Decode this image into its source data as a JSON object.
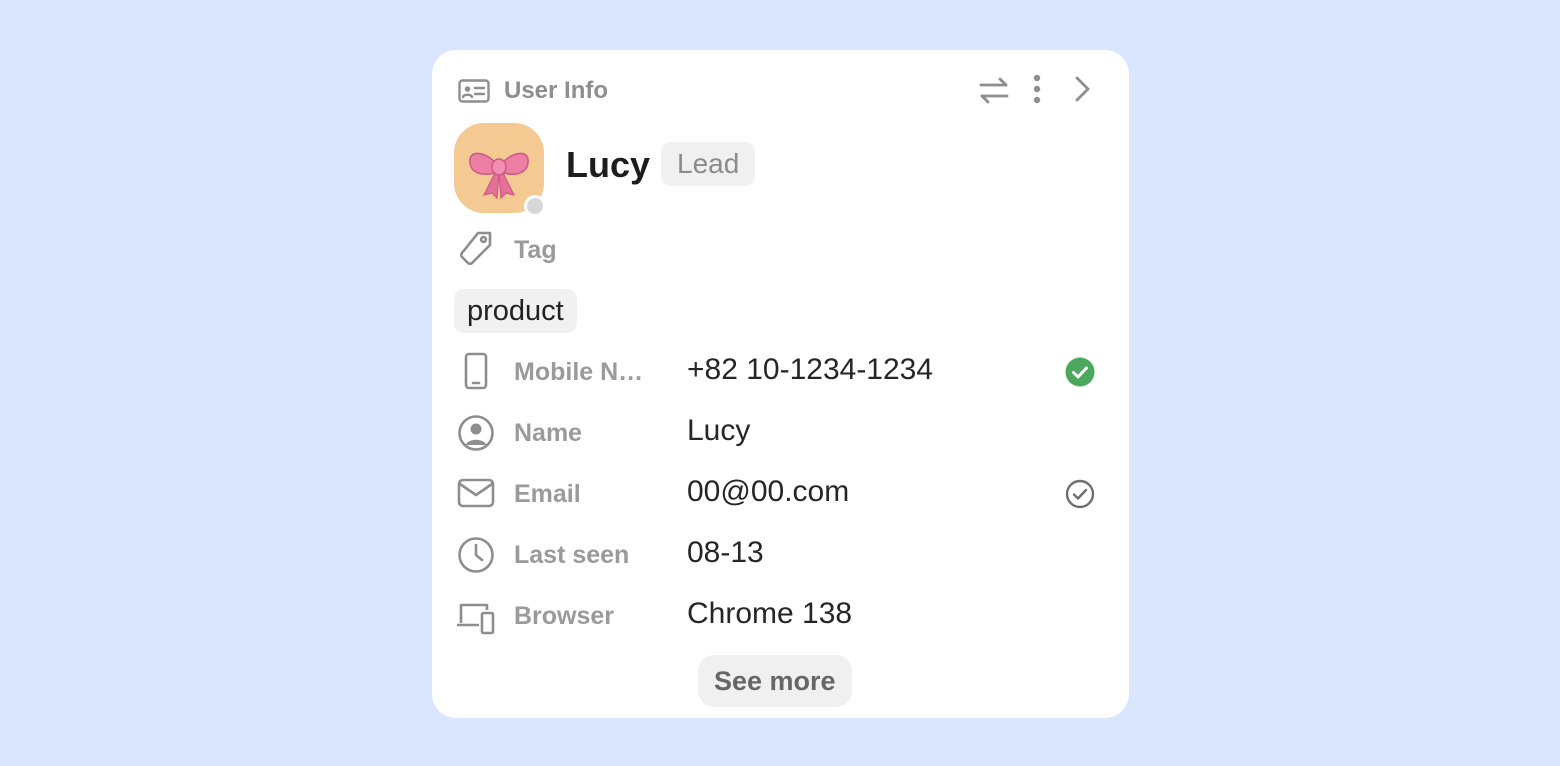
{
  "card": {
    "title": "User Info",
    "icons": {
      "header": "id-card-icon",
      "switch": "swap-arrows-icon",
      "more": "more-vertical-icon",
      "next": "chevron-right-icon"
    }
  },
  "user": {
    "name": "Lucy",
    "badge": "Lead",
    "avatar_emoji": "🎀",
    "status": "offline"
  },
  "tag_section": {
    "label": "Tag",
    "tags": [
      "product"
    ]
  },
  "fields": [
    {
      "icon": "mobile-phone-icon",
      "label": "Mobile N…",
      "value": "+82 10-1234-1234",
      "verified": true
    },
    {
      "icon": "user-circle-icon",
      "label": "Name",
      "value": "Lucy",
      "verified": null
    },
    {
      "icon": "email-icon",
      "label": "Email",
      "value": "00@00.com",
      "verified": false
    },
    {
      "icon": "clock-icon",
      "label": "Last seen",
      "value": "08-13",
      "verified": null
    },
    {
      "icon": "devices-icon",
      "label": "Browser",
      "value": "Chrome 138",
      "verified": null
    }
  ],
  "see_more_label": "See more",
  "colors": {
    "background": "#d9e6fe",
    "card": "#ffffff",
    "verified_green": "#4ba85d",
    "avatar_bg": "#f5c992",
    "muted_text": "#9a9a9a"
  }
}
